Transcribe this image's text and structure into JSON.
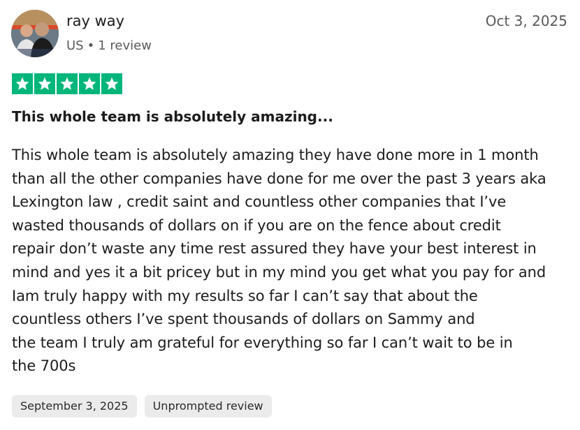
{
  "reviewer": {
    "name": "ray way",
    "country": "US",
    "separator": "•",
    "review_count": "1 review"
  },
  "review": {
    "date": "Oct 3, 2025",
    "rating": 5,
    "rating_max": 5,
    "star_color": "#00b67a",
    "title": "This whole team is absolutely amazing...",
    "body": "This whole team is absolutely amazing they have done more in 1 month\nthan all the other companies have done for me over the past 3 years aka\nLexington law , credit saint and countless other companies that I’ve\nwasted thousands of dollars on if you are on the fence about credit\nrepair don’t waste any time rest assured they have your best interest in\nmind and yes it a bit pricey but in my mind you get what you pay for and\nIam truly happy with my results so far I can’t say that about the\ncountless others I’ve spent thousands of dollars on Sammy and\nthe team I truly am grateful for everything so far I can’t wait to be in\nthe 700s",
    "experience_date": "September 3, 2025",
    "label": "Unprompted review"
  }
}
